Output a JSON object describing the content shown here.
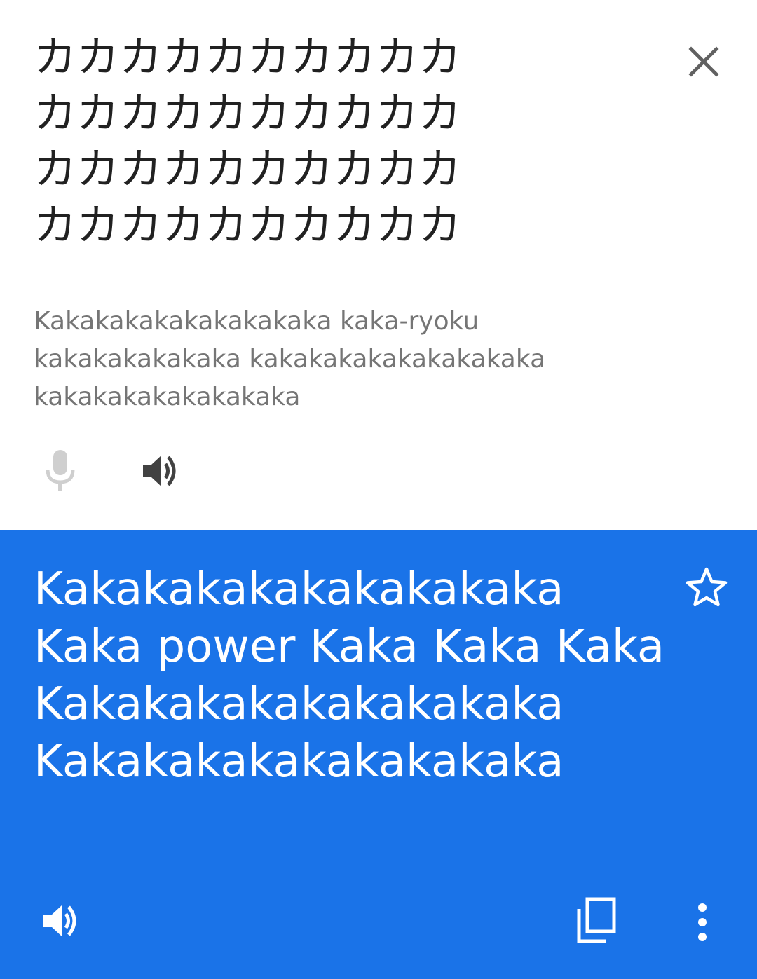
{
  "source": {
    "text_lines": [
      "カカカカカカカカカカ",
      "カカカカカカカカカカ",
      "カカカカカカカカカカ",
      "カカカカカカカカカカ"
    ],
    "romanization_lines": [
      "Kakakakakakakakakaka kaka-ryoku",
      "kakakakakakaka kakakakakakakakakaka",
      "kakakakakakakakaka"
    ],
    "close_icon": "close-icon",
    "mic_icon": "microphone-icon",
    "speaker_icon": "speaker-icon"
  },
  "translation": {
    "text_lines": [
      "Kakakakakakakakakaka",
      "Kaka power Kaka Kaka Kaka",
      "Kakakakakakakakakaka",
      "Kakakakakakakakakaka"
    ],
    "star_icon": "star-outline-icon",
    "speaker_icon": "speaker-icon",
    "copy_icon": "copy-icon",
    "more_icon": "more-vertical-icon"
  },
  "colors": {
    "translation_background": "#1a73e8",
    "source_text": "#212121",
    "romanization_text": "#757575",
    "disabled_icon": "#cfcfcf",
    "active_icon": "#424242"
  }
}
